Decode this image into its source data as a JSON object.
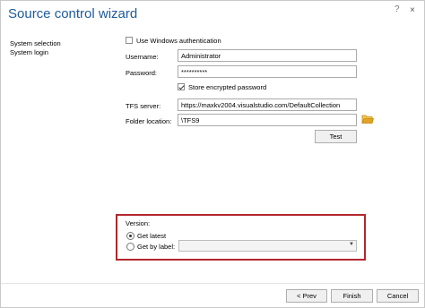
{
  "window": {
    "title": "Source control wizard",
    "help_glyph": "?",
    "close_glyph": "×"
  },
  "nav": {
    "items": [
      "System selection",
      "System login"
    ]
  },
  "form": {
    "use_windows_auth": {
      "label": "Use Windows authentication",
      "checked": false
    },
    "username": {
      "label": "Username:",
      "value": "Administrator"
    },
    "password": {
      "label": "Password:",
      "value": "**********"
    },
    "store_encrypted": {
      "label": "Store encrypted password",
      "checked": true
    },
    "tfs_server": {
      "label": "TFS server:",
      "value": "https://maxkv2004.visualstudio.com/DefaultCollection"
    },
    "folder_location": {
      "label": "Folder location:",
      "value": "\\TFS9"
    },
    "test_label": "Test"
  },
  "version": {
    "heading": "Version:",
    "get_latest_label": "Get latest",
    "get_by_label_label": "Get by label:",
    "selected": "get_latest",
    "label_value": ""
  },
  "footer": {
    "prev_label": "< Prev",
    "finish_label": "Finish",
    "cancel_label": "Cancel"
  },
  "colors": {
    "title": "#1e5b9c",
    "highlight_border": "#b3262d",
    "folder_icon": "#e0a526"
  }
}
